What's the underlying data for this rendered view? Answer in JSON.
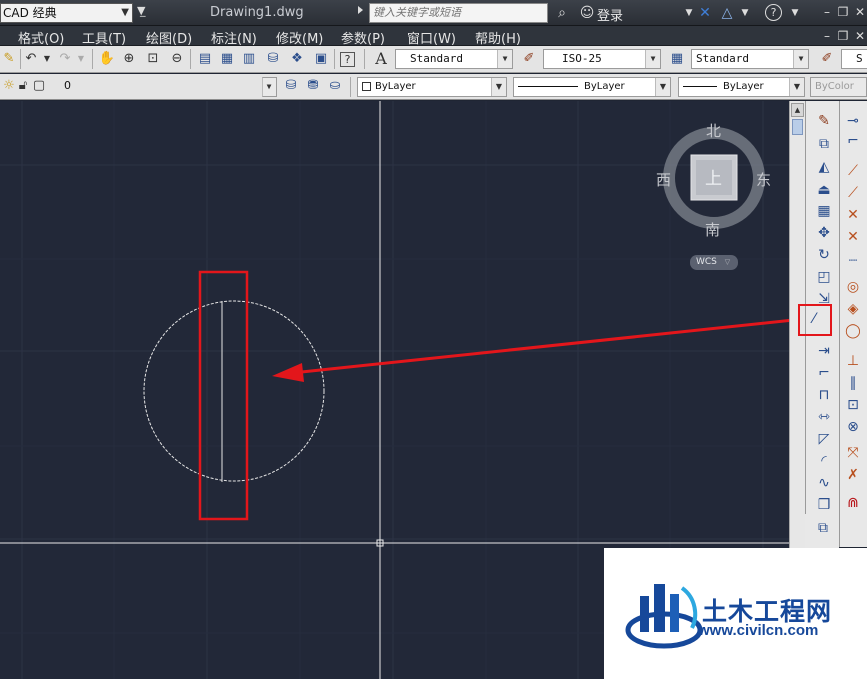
{
  "titlebar": {
    "workspace": "CAD 经典",
    "document_title": "Drawing1.dwg",
    "search_placeholder": "键入关键字或短语",
    "login_label": "登录"
  },
  "menu": {
    "items": [
      "格式(O)",
      "工具(T)",
      "绘图(D)",
      "标注(N)",
      "修改(M)",
      "参数(P)",
      "窗口(W)",
      "帮助(H)"
    ]
  },
  "toolbar_styles": {
    "text_style": "Standard",
    "dim_style": "ISO-25",
    "table_style": "Standard",
    "multileader_style_partial": "S"
  },
  "layers_toolbar": {
    "current_layer": "0",
    "color": "ByLayer",
    "linetype": "ByLayer",
    "lineweight": "ByLayer",
    "plot_style": "ByColor"
  },
  "viewcube": {
    "north": "北",
    "south": "南",
    "east": "东",
    "west": "西",
    "top_face": "上",
    "wcs_label": "WCS"
  },
  "watermark": {
    "title": "土木工程网",
    "url": "www.civilcn.com"
  },
  "colors": {
    "canvas_bg": "#222838",
    "grid_line": "#2c3345",
    "annotation_red": "#e3161b",
    "brand_blue": "#16489a"
  },
  "icons": {
    "highlighted_tool": "construction-line-icon"
  }
}
